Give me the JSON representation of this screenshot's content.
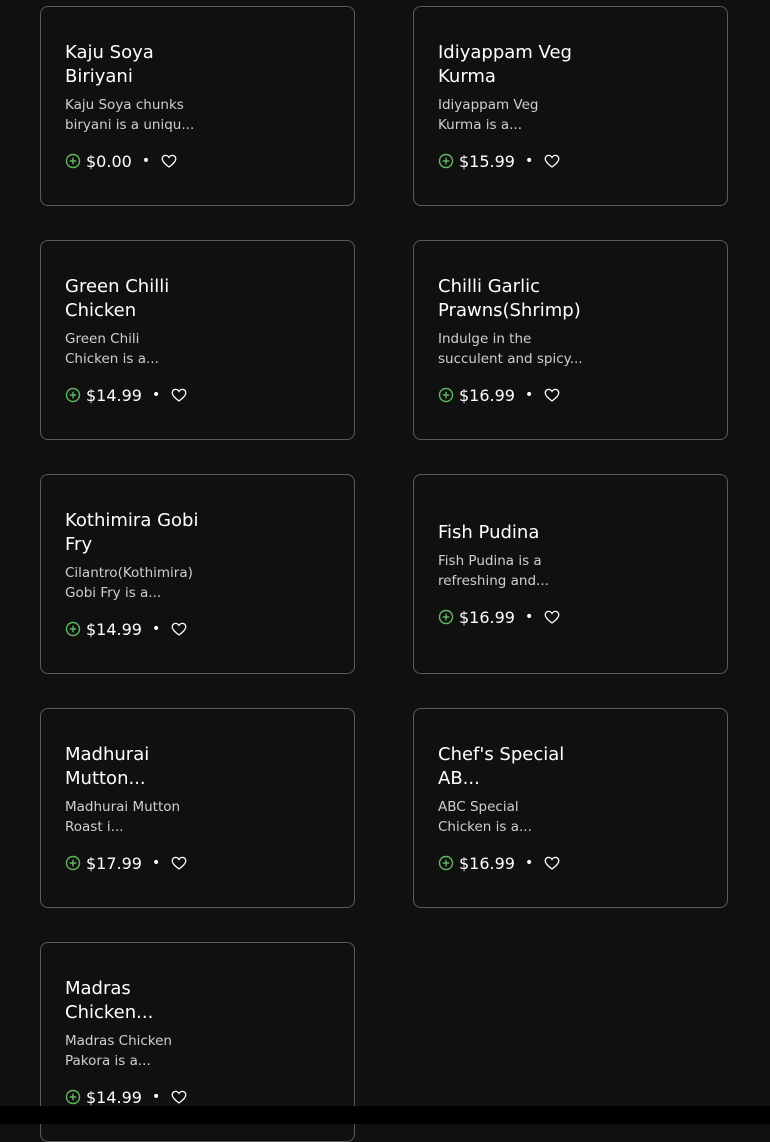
{
  "theme": {
    "accent": "#5fb85f",
    "card_border": "#5a5a5a",
    "background": "#101010"
  },
  "items": [
    {
      "title": "Kaju Soya Biriyani",
      "description": "Kaju Soya chunks biryani is a uniqu...",
      "price": "$0.00",
      "bullet": "•",
      "add_icon": "add-circle-icon",
      "fav_icon": "heart-icon"
    },
    {
      "title": "Idiyappam Veg Kurma",
      "description": "Idiyappam Veg Kurma is a...",
      "price": "$15.99",
      "bullet": "•",
      "add_icon": "add-circle-icon",
      "fav_icon": "heart-icon"
    },
    {
      "title": "Green Chilli Chicken",
      "description": "Green Chili Chicken is a...",
      "price": "$14.99",
      "bullet": "•",
      "add_icon": "add-circle-icon",
      "fav_icon": "heart-icon"
    },
    {
      "title": "Chilli Garlic Prawns(Shrimp)",
      "description": "Indulge in the succulent and spicy...",
      "price": "$16.99",
      "bullet": "•",
      "add_icon": "add-circle-icon",
      "fav_icon": "heart-icon"
    },
    {
      "title": "Kothimira Gobi Fry",
      "description": "Cilantro(Kothimira) Gobi Fry is a...",
      "price": "$14.99",
      "bullet": "•",
      "add_icon": "add-circle-icon",
      "fav_icon": "heart-icon"
    },
    {
      "title": "Fish Pudina",
      "description": "Fish Pudina is a refreshing and...",
      "price": "$16.99",
      "bullet": "•",
      "add_icon": "add-circle-icon",
      "fav_icon": "heart-icon"
    },
    {
      "title": "Madhurai Mutton...",
      "description": "Madhurai Mutton Roast i...",
      "price": "$17.99",
      "bullet": "•",
      "add_icon": "add-circle-icon",
      "fav_icon": "heart-icon"
    },
    {
      "title": "Chef's Special AB...",
      "description": "ABC Special Chicken is a...",
      "price": "$16.99",
      "bullet": "•",
      "add_icon": "add-circle-icon",
      "fav_icon": "heart-icon"
    },
    {
      "title": "Madras Chicken...",
      "description": "Madras Chicken Pakora is a...",
      "price": "$14.99",
      "bullet": "•",
      "add_icon": "add-circle-icon",
      "fav_icon": "heart-icon"
    }
  ]
}
